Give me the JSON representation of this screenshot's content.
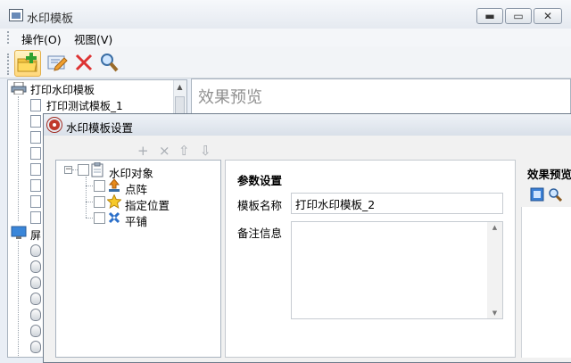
{
  "main_window": {
    "title": "水印模板",
    "menu": [
      "操作(O)",
      "视图(V)"
    ],
    "toolbar_icons": [
      "new-folder-icon",
      "edit-icon",
      "delete-icon",
      "search-icon"
    ]
  },
  "left_tree": {
    "root_print": "打印水印模板",
    "first_child": "打印测试模板_1",
    "root_screen": "屏"
  },
  "preview": {
    "title": "效果预览"
  },
  "dialog": {
    "title": "水印模板设置",
    "tree_tools": [
      "+",
      "×",
      "⇧",
      "⇩"
    ],
    "tree": {
      "root": "水印对象",
      "children": [
        "点阵",
        "指定位置",
        "平铺"
      ]
    },
    "params": {
      "section_title": "参数设置",
      "name_label": "模板名称",
      "name_value": "打印水印模板_2",
      "notes_label": "备注信息",
      "notes_value": ""
    },
    "preview_title": "效果预览"
  },
  "colors": {
    "accent_red": "#c0392b",
    "toolbar_highlight": "#ffd87a"
  }
}
